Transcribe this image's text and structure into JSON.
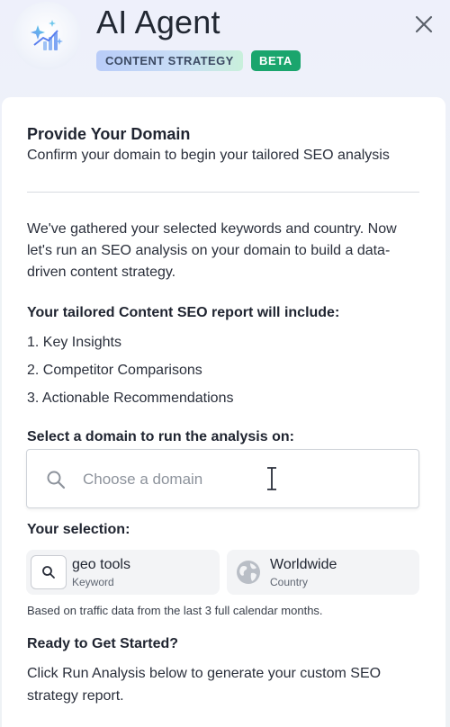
{
  "header": {
    "title": "AI Agent",
    "tag": "CONTENT STRATEGY",
    "badge": "BETA",
    "logo_icon": "sparkle-chart-icon",
    "close_icon": "close-icon"
  },
  "panel": {
    "heading": "Provide Your Domain",
    "subheading": "Confirm your domain to begin your tailored SEO analysis",
    "intro": "We've gathered your selected keywords and country. Now let's run an SEO analysis on your domain to build a data-driven content strategy.",
    "report_heading": "Your tailored Content SEO report will include:",
    "report_items": [
      "1. Key Insights",
      "2. Competitor Comparisons",
      "3. Actionable Recommendations"
    ],
    "domain_label": "Select a domain to run the analysis on:",
    "domain_placeholder": "Choose a domain",
    "domain_value": "",
    "selection_label": "Your selection:",
    "keyword": {
      "name": "geo tools",
      "kind": "Keyword",
      "icon": "search-icon"
    },
    "country": {
      "name": "Worldwide",
      "kind": "Country",
      "icon": "globe-icon"
    },
    "note": "Based on traffic data from the last 3 full calendar months.",
    "ready_heading": "Ready to Get Started?",
    "outro": "Click Run Analysis below to generate your custom SEO strategy report."
  },
  "colors": {
    "beta_green": "#1aa56d",
    "text_dark": "#1f2430",
    "placeholder": "#8d939c"
  }
}
